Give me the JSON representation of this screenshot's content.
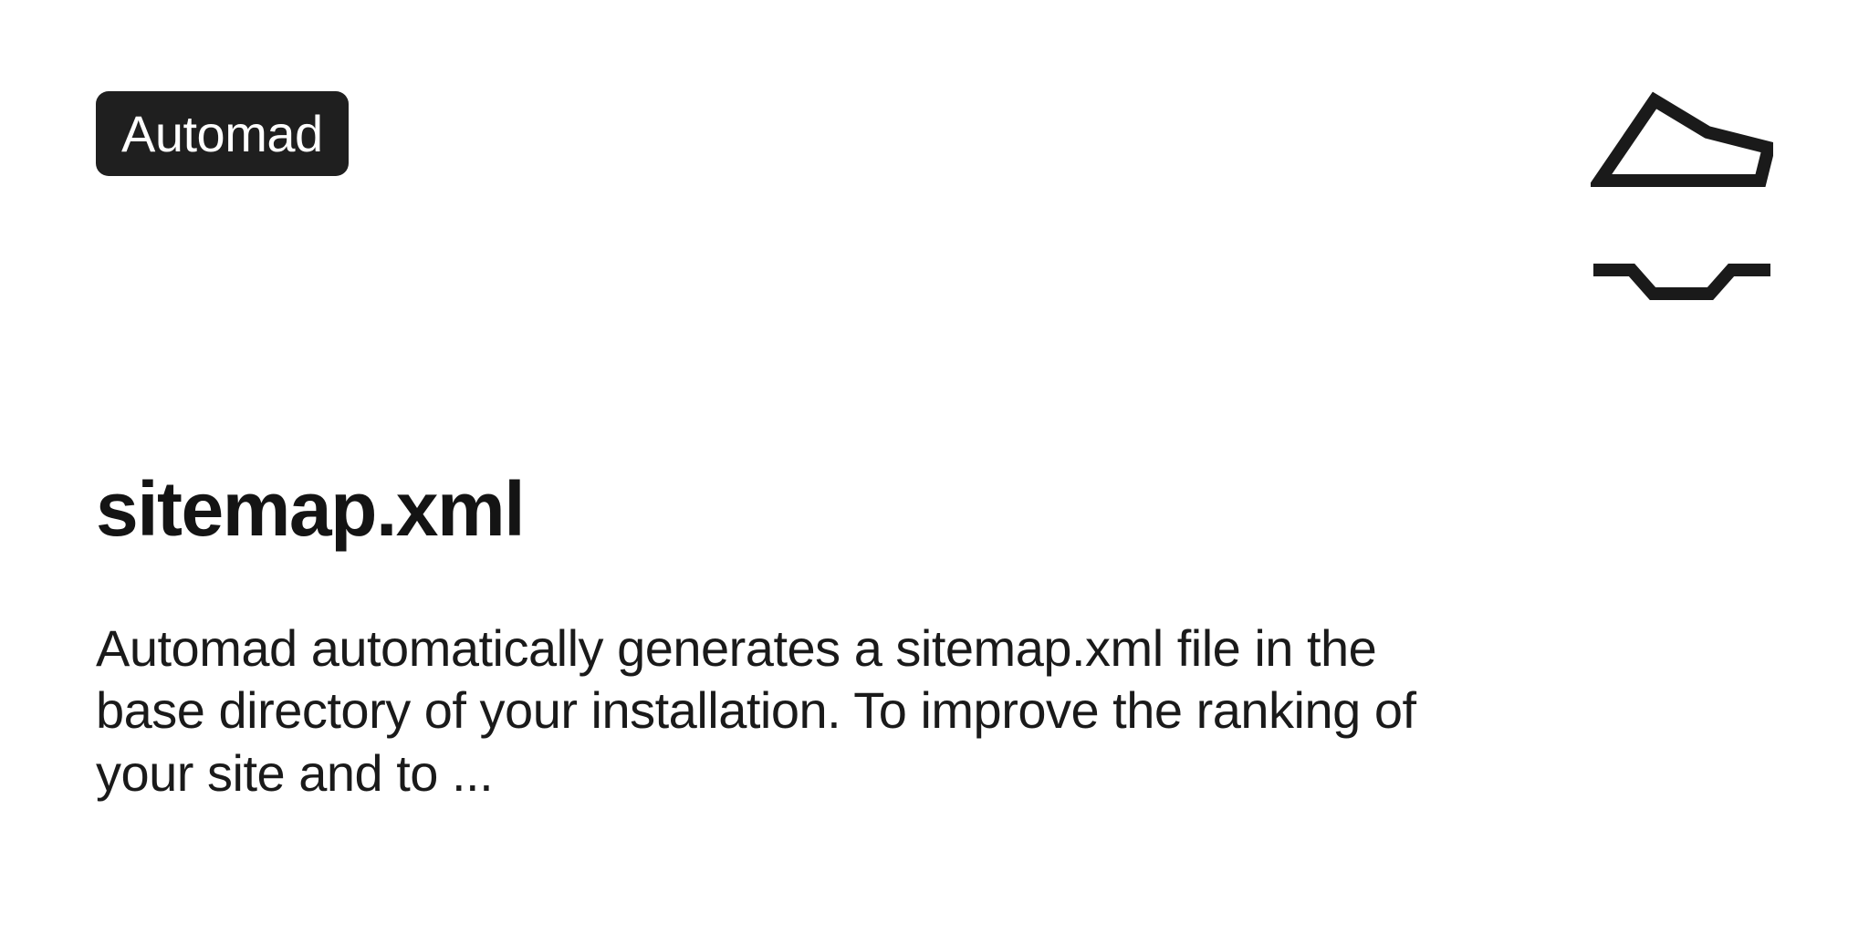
{
  "badge": {
    "label": "Automad"
  },
  "page": {
    "title": "sitemap.xml",
    "description": "Automad automatically generates a sitemap.xml file in the base directory of your installation. To improve the ranking of your site and to ..."
  }
}
